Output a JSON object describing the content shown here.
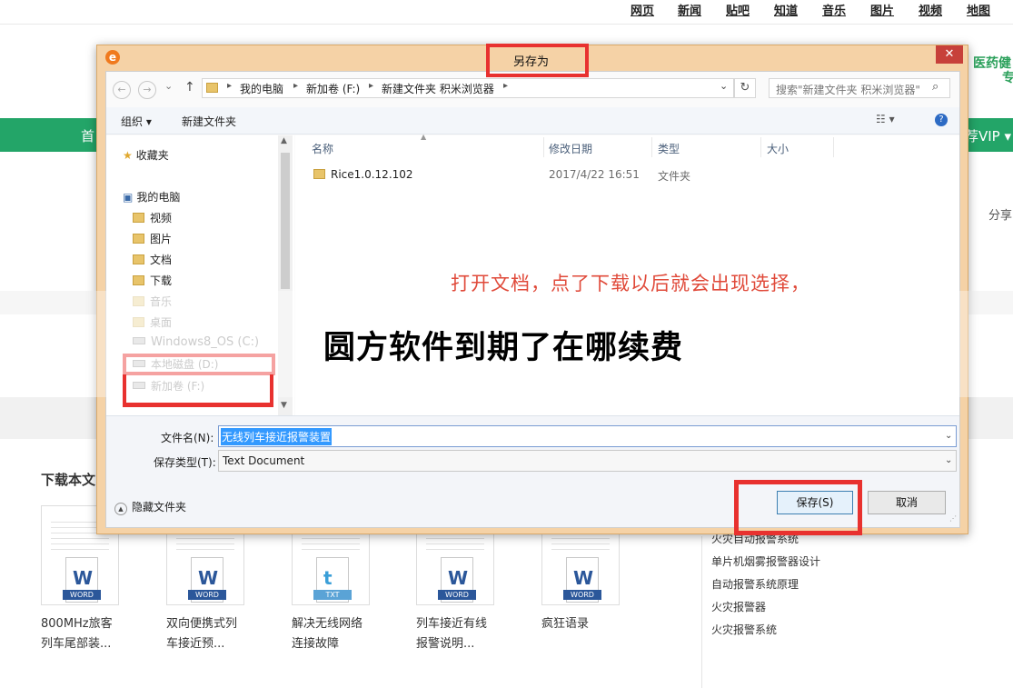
{
  "background_page": {
    "top_nav": [
      "网页",
      "新闻",
      "贴吧",
      "知道",
      "音乐",
      "图片",
      "视频",
      "地图"
    ],
    "green_bar_left": "首",
    "green_bar_right": "荐VIP ▾",
    "side_green_text": [
      "医药健",
      "专"
    ],
    "share_text": "分享",
    "download_heading": "下载本文",
    "docs": [
      {
        "type": "WORD",
        "letter": "W",
        "caption": [
          "800MHz旅客",
          "列车尾部装..."
        ]
      },
      {
        "type": "WORD",
        "letter": "W",
        "caption": [
          "双向便携式列",
          "车接近预..."
        ]
      },
      {
        "type": "TXT",
        "letter": "t",
        "caption": [
          "解决无线网络",
          "连接故障"
        ]
      },
      {
        "type": "WORD",
        "letter": "W",
        "caption": [
          "列车接近有线",
          "报警说明..."
        ]
      },
      {
        "type": "WORD",
        "letter": "W",
        "caption": [
          "疯狂语录",
          ""
        ]
      }
    ],
    "related_links": [
      "火灾自动报警系统",
      "单片机烟雾报警器设计",
      "自动报警系统原理",
      "火灾报警器",
      "火灾报警系统"
    ]
  },
  "dialog": {
    "title": "另存为",
    "app_icon": "e",
    "close_label": "✕",
    "nav": {
      "back_icon": "←",
      "forward_icon": "→",
      "dropdown_icon": "⌄",
      "up_icon": "↑"
    },
    "breadcrumbs": [
      "我的电脑",
      "新加卷 (F:)",
      "新建文件夹 积米浏览器"
    ],
    "search_placeholder": "搜索\"新建文件夹 积米浏览器\"",
    "toolbar": {
      "organize": "组织 ▾",
      "new_folder": "新建文件夹",
      "view_icon": "☷ ▾",
      "help_icon": "?"
    },
    "nav_pane": {
      "favorites": "收藏夹",
      "computer": "我的电脑",
      "items": [
        "视频",
        "图片",
        "文档",
        "下载",
        "音乐",
        "桌面"
      ],
      "drives": [
        "Windows8_OS (C:)",
        "本地磁盘 (D:)",
        "新加卷 (F:)"
      ]
    },
    "columns": [
      "名称",
      "修改日期",
      "类型",
      "大小"
    ],
    "files": [
      {
        "name": "Rice1.0.12.102",
        "modified": "2017/4/22 16:51",
        "type": "文件夹",
        "size": ""
      }
    ],
    "filename_label": "文件名(N):",
    "filename_value": "无线列车接近报警装置",
    "filetype_label": "保存类型(T):",
    "filetype_value": "Text Document",
    "hide_folders": "隐藏文件夹",
    "save_button": "保存(S)",
    "cancel_button": "取消"
  },
  "annotation_text": "打开文档，点了下载以后就会出现选择，",
  "overlay_title": "圆方软件到期了在哪续费",
  "colors": {
    "highlight": "#e8312f",
    "green_bar": "#23a568",
    "dialog_frame": "#f5d2a6",
    "annotation": "#e04a3a"
  }
}
